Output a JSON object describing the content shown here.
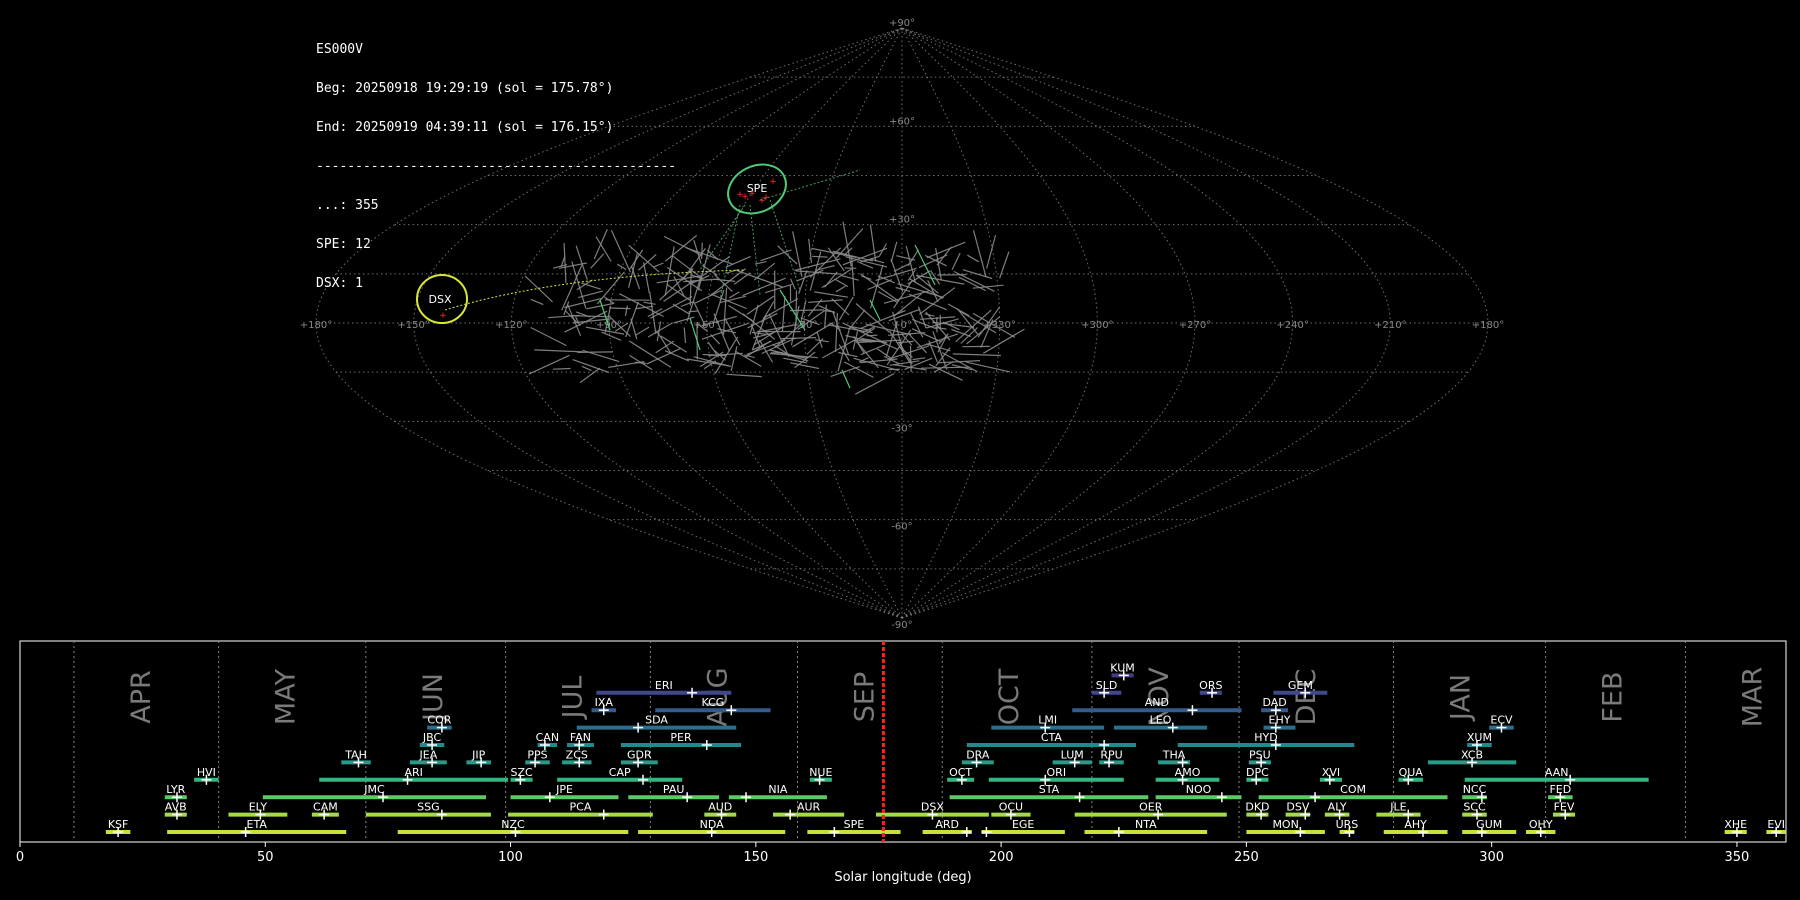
{
  "info": {
    "station": "ES000V",
    "begin": "Beg: 20250918 19:29:19 (sol = 175.78°)",
    "end": "End: 20250919 04:39:11 (sol = 176.15°)",
    "separator": "----------------------------------------------",
    "sporadic_count": "...: 355",
    "spe_count": "SPE: 12",
    "dsx_count": "DSX: 1"
  },
  "sky_map": {
    "lon_labels": [
      "+180°",
      "+150°",
      "+120°",
      "+90°",
      "+60°",
      "+30°",
      "+0°",
      "+330°",
      "+300°",
      "+270°",
      "+240°",
      "+210°",
      "+180°"
    ],
    "lat_labels": [
      "+90°",
      "+60°",
      "+30°",
      "-30°",
      "-60°",
      "-90°"
    ],
    "active_showers": [
      {
        "code": "SPE",
        "color": "#4fc97a"
      },
      {
        "code": "DSX",
        "color": "#d8e63a"
      }
    ],
    "colors": {
      "sporadic": "#8c8c8c",
      "spe": "#4fc97a",
      "dsx": "#d8e63a",
      "radiant": "#ff3030"
    }
  },
  "chart_data": {
    "type": "range-timeline",
    "xlabel": "Solar longitude (deg)",
    "xlim": [
      0,
      360
    ],
    "xticks": [
      0,
      50,
      100,
      150,
      200,
      250,
      300,
      350
    ],
    "current_sol": 176,
    "months": [
      {
        "name": "APR",
        "boundary": 11
      },
      {
        "name": "MAY",
        "boundary": 40.5
      },
      {
        "name": "JUN",
        "boundary": 70.5
      },
      {
        "name": "JUL",
        "boundary": 99
      },
      {
        "name": "AUG",
        "boundary": 128.5
      },
      {
        "name": "SEP",
        "boundary": 158.5
      },
      {
        "name": "OCT",
        "boundary": 188
      },
      {
        "name": "NOV",
        "boundary": 218.5
      },
      {
        "name": "DEC",
        "boundary": 248.5
      },
      {
        "name": "JAN",
        "boundary": 280
      },
      {
        "name": "FEB",
        "boundary": 311
      },
      {
        "name": "MAR",
        "boundary": 339.5
      }
    ],
    "showers": [
      {
        "code": "KSF",
        "start": 17.5,
        "end": 22.5,
        "peak": 20,
        "row": 0
      },
      {
        "code": "ETA",
        "start": 30,
        "end": 66.5,
        "peak": 46,
        "row": 0
      },
      {
        "code": "NZC",
        "start": 77,
        "end": 124,
        "peak": 101,
        "row": 0
      },
      {
        "code": "NDA",
        "start": 126,
        "end": 156,
        "peak": 141,
        "row": 0
      },
      {
        "code": "SPE",
        "start": 160.5,
        "end": 179.5,
        "peak": 166,
        "row": 0
      },
      {
        "code": "ARD",
        "start": 184,
        "end": 194,
        "peak": 193,
        "row": 0
      },
      {
        "code": "EGE",
        "start": 196,
        "end": 213,
        "peak": 197,
        "row": 0
      },
      {
        "code": "NTA",
        "start": 217,
        "end": 242,
        "peak": 224,
        "row": 0
      },
      {
        "code": "MON",
        "start": 250,
        "end": 266,
        "peak": 261,
        "row": 0
      },
      {
        "code": "URS",
        "start": 269,
        "end": 272,
        "peak": 271,
        "row": 0
      },
      {
        "code": "AHY",
        "start": 278,
        "end": 291,
        "peak": 286,
        "row": 0
      },
      {
        "code": "GUM",
        "start": 294,
        "end": 305,
        "peak": 298,
        "row": 0
      },
      {
        "code": "OHY",
        "start": 307,
        "end": 313,
        "peak": 310,
        "row": 0
      },
      {
        "code": "XHE",
        "start": 347.5,
        "end": 352,
        "peak": 350,
        "row": 0
      },
      {
        "code": "EVI",
        "start": 356,
        "end": 360,
        "peak": 358,
        "row": 0
      },
      {
        "code": "AVB",
        "start": 29.5,
        "end": 34,
        "peak": 32,
        "row": 1
      },
      {
        "code": "ELY",
        "start": 42.5,
        "end": 54.5,
        "peak": 49,
        "row": 1
      },
      {
        "code": "CAM",
        "start": 59.5,
        "end": 65,
        "peak": 62,
        "row": 1
      },
      {
        "code": "SSG",
        "start": 70.5,
        "end": 96,
        "peak": 86,
        "row": 1
      },
      {
        "code": "PCA",
        "start": 99.5,
        "end": 129,
        "peak": 119,
        "row": 1
      },
      {
        "code": "AUD",
        "start": 139.5,
        "end": 146,
        "peak": 143,
        "row": 1
      },
      {
        "code": "AUR",
        "start": 153.5,
        "end": 168,
        "peak": 157,
        "row": 1
      },
      {
        "code": "DSX",
        "start": 174.5,
        "end": 197.5,
        "peak": 186,
        "row": 1
      },
      {
        "code": "OCU",
        "start": 198,
        "end": 206,
        "peak": 202,
        "row": 1
      },
      {
        "code": "OER",
        "start": 215,
        "end": 246,
        "peak": 232,
        "row": 1
      },
      {
        "code": "DKD",
        "start": 250,
        "end": 254.5,
        "peak": 253,
        "row": 1
      },
      {
        "code": "DSV",
        "start": 258,
        "end": 263,
        "peak": 262,
        "row": 1
      },
      {
        "code": "ALY",
        "start": 266,
        "end": 271,
        "peak": 269,
        "row": 1
      },
      {
        "code": "JLE",
        "start": 276.5,
        "end": 285.5,
        "peak": 283,
        "row": 1
      },
      {
        "code": "SCC",
        "start": 294,
        "end": 299,
        "peak": 297,
        "row": 1
      },
      {
        "code": "FEV",
        "start": 312.5,
        "end": 317,
        "peak": 315,
        "row": 1
      },
      {
        "code": "LYR",
        "start": 29.5,
        "end": 34,
        "peak": 32,
        "row": 2
      },
      {
        "code": "JMC",
        "start": 49.5,
        "end": 95,
        "peak": 74,
        "row": 2
      },
      {
        "code": "JPE",
        "start": 100,
        "end": 122,
        "peak": 108,
        "row": 2
      },
      {
        "code": "PAU",
        "start": 124,
        "end": 142.5,
        "peak": 136,
        "row": 2
      },
      {
        "code": "NIA",
        "start": 144.5,
        "end": 164.5,
        "peak": 148,
        "row": 2
      },
      {
        "code": "STA",
        "start": 189.5,
        "end": 230,
        "peak": 216,
        "row": 2
      },
      {
        "code": "NOO",
        "start": 231.5,
        "end": 249,
        "peak": 245,
        "row": 2
      },
      {
        "code": "COM",
        "start": 252.5,
        "end": 291,
        "peak": 264,
        "row": 2
      },
      {
        "code": "NCC",
        "start": 294,
        "end": 299,
        "peak": 298,
        "row": 2
      },
      {
        "code": "FED",
        "start": 311.5,
        "end": 316.5,
        "peak": 314,
        "row": 2
      },
      {
        "code": "HVI",
        "start": 35.5,
        "end": 40.5,
        "peak": 38,
        "row": 3
      },
      {
        "code": "ARI",
        "start": 61,
        "end": 99.5,
        "peak": 79,
        "row": 3
      },
      {
        "code": "SZC",
        "start": 100,
        "end": 104.5,
        "peak": 102,
        "row": 3
      },
      {
        "code": "CAP",
        "start": 109.5,
        "end": 135,
        "peak": 127,
        "row": 3
      },
      {
        "code": "NUE",
        "start": 161,
        "end": 165.5,
        "peak": 163,
        "row": 3
      },
      {
        "code": "OCT",
        "start": 189,
        "end": 194.5,
        "peak": 192,
        "row": 3
      },
      {
        "code": "ORI",
        "start": 197.5,
        "end": 225,
        "peak": 209,
        "row": 3
      },
      {
        "code": "AMO",
        "start": 231.5,
        "end": 244.5,
        "peak": 237,
        "row": 3
      },
      {
        "code": "DPC",
        "start": 250,
        "end": 254.5,
        "peak": 252,
        "row": 3
      },
      {
        "code": "XVI",
        "start": 265,
        "end": 269.5,
        "peak": 267,
        "row": 3
      },
      {
        "code": "QUA",
        "start": 281,
        "end": 286,
        "peak": 283,
        "row": 3
      },
      {
        "code": "AAN",
        "start": 294.5,
        "end": 332,
        "peak": 316,
        "row": 3
      },
      {
        "code": "TAH",
        "start": 65.5,
        "end": 71.5,
        "peak": 69,
        "row": 4
      },
      {
        "code": "JEA",
        "start": 79.5,
        "end": 87,
        "peak": 84,
        "row": 4
      },
      {
        "code": "JIP",
        "start": 91,
        "end": 96,
        "peak": 94,
        "row": 4
      },
      {
        "code": "PPS",
        "start": 103,
        "end": 108,
        "peak": 105,
        "row": 4
      },
      {
        "code": "ZCS",
        "start": 110.5,
        "end": 116.5,
        "peak": 114,
        "row": 4
      },
      {
        "code": "GDR",
        "start": 122.5,
        "end": 130,
        "peak": 126,
        "row": 4
      },
      {
        "code": "DRA",
        "start": 192,
        "end": 198.5,
        "peak": 195,
        "row": 4
      },
      {
        "code": "LUM",
        "start": 210.5,
        "end": 218.5,
        "peak": 215,
        "row": 4
      },
      {
        "code": "RPU",
        "start": 220,
        "end": 225,
        "peak": 222,
        "row": 4
      },
      {
        "code": "THA",
        "start": 232,
        "end": 238.5,
        "peak": 237,
        "row": 4
      },
      {
        "code": "PSU",
        "start": 250.5,
        "end": 255,
        "peak": 253,
        "row": 4
      },
      {
        "code": "XCB",
        "start": 287,
        "end": 305,
        "peak": 296,
        "row": 4
      },
      {
        "code": "JBC",
        "start": 81.5,
        "end": 86.5,
        "peak": 84,
        "row": 5
      },
      {
        "code": "CAN",
        "start": 105.5,
        "end": 109.5,
        "peak": 107,
        "row": 5
      },
      {
        "code": "FAN",
        "start": 111.5,
        "end": 117,
        "peak": 114,
        "row": 5
      },
      {
        "code": "PER",
        "start": 122.5,
        "end": 147,
        "peak": 140,
        "row": 5
      },
      {
        "code": "CTA",
        "start": 193,
        "end": 227.5,
        "peak": 221,
        "row": 5
      },
      {
        "code": "HYD",
        "start": 236,
        "end": 272,
        "peak": 256,
        "row": 5
      },
      {
        "code": "XUM",
        "start": 295,
        "end": 300,
        "peak": 297,
        "row": 5
      },
      {
        "code": "COR",
        "start": 83,
        "end": 88,
        "peak": 86,
        "row": 6
      },
      {
        "code": "SDA",
        "start": 113.5,
        "end": 146,
        "peak": 126,
        "row": 6
      },
      {
        "code": "LMI",
        "start": 198,
        "end": 221,
        "peak": 209,
        "row": 6
      },
      {
        "code": "LEO",
        "start": 223,
        "end": 242,
        "peak": 235,
        "row": 6
      },
      {
        "code": "EHY",
        "start": 253.5,
        "end": 260,
        "peak": 256,
        "row": 6
      },
      {
        "code": "ECV",
        "start": 299.5,
        "end": 304.5,
        "peak": 302,
        "row": 6
      },
      {
        "code": "IXA",
        "start": 116.5,
        "end": 121.5,
        "peak": 119,
        "row": 7
      },
      {
        "code": "KCG",
        "start": 129.5,
        "end": 153,
        "peak": 145,
        "row": 7
      },
      {
        "code": "AND",
        "start": 214.5,
        "end": 249,
        "peak": 239,
        "row": 7
      },
      {
        "code": "DAD",
        "start": 253,
        "end": 258.5,
        "peak": 256,
        "row": 7
      },
      {
        "code": "ERI",
        "start": 117.5,
        "end": 145,
        "peak": 137,
        "row": 8
      },
      {
        "code": "SLD",
        "start": 218.5,
        "end": 224.5,
        "peak": 221,
        "row": 8
      },
      {
        "code": "ORS",
        "start": 240.5,
        "end": 245,
        "peak": 243,
        "row": 8
      },
      {
        "code": "GEM",
        "start": 255.5,
        "end": 266.5,
        "peak": 262,
        "row": 8
      },
      {
        "code": "KUM",
        "start": 222.5,
        "end": 227,
        "peak": 225,
        "row": 9
      }
    ]
  }
}
